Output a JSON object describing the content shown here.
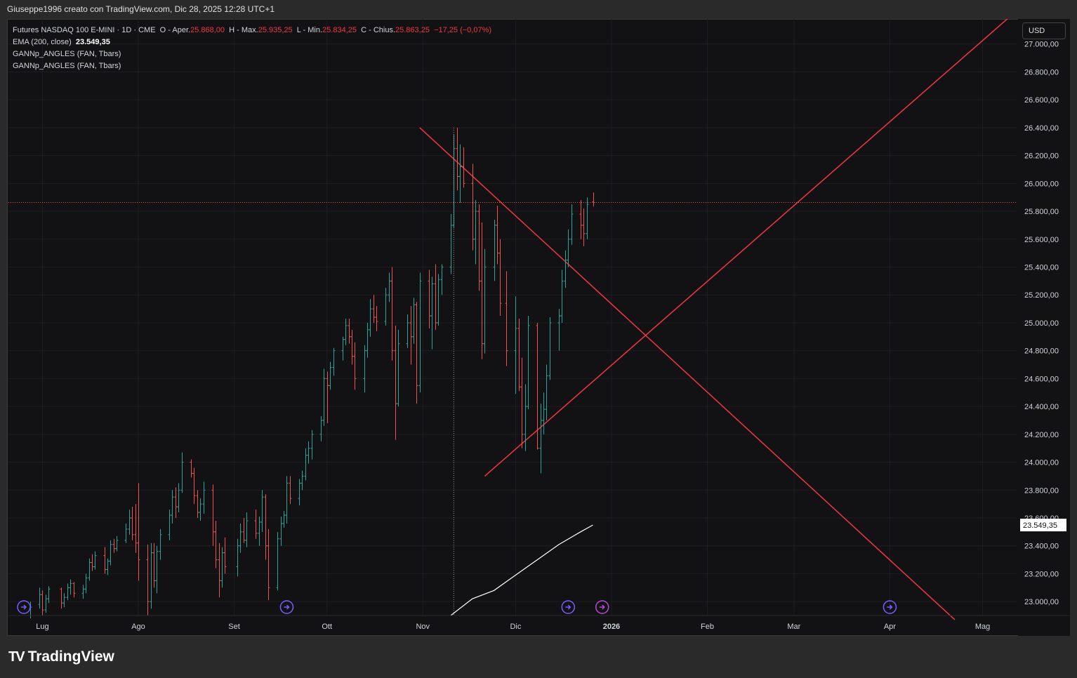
{
  "header": {
    "attribution": "Giuseppe1996 creato con TradingView.com, Dic 28, 2025 12:28 UTC+1"
  },
  "legend": {
    "symbol": "Futures NASDAQ 100 E-MINI · 1D · CME",
    "open_label": "O - Aper.",
    "open": "25.868,00",
    "high_label": "H - Max.",
    "high": "25.935,25",
    "low_label": "L - Min.",
    "low": "25.834,25",
    "close_label": "C - Chius.",
    "close": "25.863,25",
    "change": "−17,25 (−0,07%)",
    "ema_label": "EMA (200, close)",
    "ema_value": "23.549,35",
    "indicator1": "GANNp_ANGLES (FAN, Tbars)",
    "indicator2": "GANNp_ANGLES (FAN, Tbars)"
  },
  "currency": "USD",
  "footer": {
    "brand": "TradingView",
    "logo_text": "TV"
  },
  "colors": {
    "background": "#121214",
    "up": "#26a69a",
    "down": "#ef5350",
    "gann": "#f23645",
    "ema": "#ffffff",
    "event_icon": "#7b5cff",
    "event_icon_alt": "#b04dd6"
  },
  "chart_data": {
    "type": "ohlc",
    "title": "Futures NASDAQ 100 E-MINI · 1D · CME",
    "y_axis": {
      "min": 22900,
      "max": 27180,
      "ticks": [
        "27.000,00",
        "26.800,00",
        "26.600,00",
        "26.400,00",
        "26.200,00",
        "26.000,00",
        "25.800,00",
        "25.600,00",
        "25.400,00",
        "25.200,00",
        "25.000,00",
        "24.800,00",
        "24.600,00",
        "24.400,00",
        "24.200,00",
        "24.000,00",
        "23.800,00",
        "23.600,00",
        "23.400,00",
        "23.200,00",
        "23.000,00"
      ],
      "tick_values": [
        27000,
        26800,
        26600,
        26400,
        26200,
        26000,
        25800,
        25600,
        25400,
        25200,
        25000,
        24800,
        24600,
        24400,
        24200,
        24000,
        23800,
        23600,
        23400,
        23200,
        23000
      ]
    },
    "x_axis": {
      "labels": [
        "Lug",
        "Ago",
        "Set",
        "Ott",
        "Nov",
        "Dic",
        "2026",
        "Feb",
        "Mar",
        "Apr",
        "Mag"
      ],
      "label_dates": [
        "2025-07-01",
        "2025-08-01",
        "2025-09-01",
        "2025-10-01",
        "2025-11-01",
        "2025-12-01",
        "2026-01-01",
        "2026-02-01",
        "2026-03-01",
        "2026-04-01",
        "2026-05-01"
      ],
      "start": "2025-06-20",
      "end": "2026-05-12"
    },
    "grid": true,
    "last_price": 25863.25,
    "ema_value_label": "23.549,35",
    "ema_value": 23549.35,
    "ema": {
      "name": "EMA (200, close)",
      "points": [
        [
          "2025-11-10",
          22900
        ],
        [
          "2025-11-17",
          23020
        ],
        [
          "2025-11-24",
          23080
        ],
        [
          "2025-12-01",
          23190
        ],
        [
          "2025-12-08",
          23300
        ],
        [
          "2025-12-15",
          23410
        ],
        [
          "2025-12-22",
          23500
        ],
        [
          "2025-12-26",
          23549.35
        ]
      ]
    },
    "gann_lines": [
      {
        "name": "GANNp_ANGLES fan down",
        "from": [
          "2025-10-31",
          26400
        ],
        "to": [
          "2026-04-22",
          22870
        ]
      },
      {
        "name": "GANNp_ANGLES fan up",
        "from": [
          "2025-11-21",
          23900
        ],
        "to": [
          "2026-05-10",
          27200
        ]
      }
    ],
    "event_markers": [
      "2025-06-25",
      "2025-09-18",
      "2025-12-18",
      "2025-12-29",
      "2026-04-01"
    ],
    "bars": [
      [
        "2025-06-27",
        22950,
        23000,
        22880,
        22960
      ],
      [
        "2025-06-30",
        22980,
        23100,
        22950,
        23050
      ],
      [
        "2025-07-01",
        23050,
        23080,
        22900,
        22940
      ],
      [
        "2025-07-02",
        22940,
        23050,
        22920,
        23020
      ],
      [
        "2025-07-03",
        23020,
        23110,
        22990,
        23090
      ],
      [
        "2025-07-07",
        23090,
        23100,
        22950,
        22990
      ],
      [
        "2025-07-08",
        22990,
        23060,
        22960,
        23030
      ],
      [
        "2025-07-09",
        23030,
        23130,
        23010,
        23100
      ],
      [
        "2025-07-10",
        23100,
        23160,
        23050,
        23130
      ],
      [
        "2025-07-11",
        23130,
        23140,
        23030,
        23060
      ],
      [
        "2025-07-14",
        23060,
        23120,
        23020,
        23090
      ],
      [
        "2025-07-15",
        23090,
        23200,
        23060,
        23170
      ],
      [
        "2025-07-16",
        23170,
        23310,
        23150,
        23280
      ],
      [
        "2025-07-17",
        23280,
        23340,
        23220,
        23250
      ],
      [
        "2025-07-18",
        23250,
        23360,
        23230,
        23330
      ],
      [
        "2025-07-21",
        23330,
        23390,
        23200,
        23230
      ],
      [
        "2025-07-22",
        23230,
        23310,
        23190,
        23290
      ],
      [
        "2025-07-23",
        23290,
        23440,
        23260,
        23410
      ],
      [
        "2025-07-24",
        23410,
        23450,
        23350,
        23380
      ],
      [
        "2025-07-25",
        23380,
        23470,
        23360,
        23440
      ],
      [
        "2025-07-28",
        23440,
        23560,
        23420,
        23520
      ],
      [
        "2025-07-29",
        23520,
        23660,
        23480,
        23600
      ],
      [
        "2025-07-30",
        23600,
        23680,
        23440,
        23480
      ],
      [
        "2025-07-31",
        23480,
        23700,
        23350,
        23420
      ],
      [
        "2025-08-01",
        23420,
        23850,
        23150,
        23300
      ],
      [
        "2025-08-04",
        23300,
        23410,
        22900,
        23000
      ],
      [
        "2025-08-05",
        23000,
        23420,
        22950,
        23350
      ],
      [
        "2025-08-06",
        23350,
        23420,
        23100,
        23150
      ],
      [
        "2025-08-07",
        23150,
        23400,
        23060,
        23360
      ],
      [
        "2025-08-08",
        23360,
        23520,
        23300,
        23480
      ],
      [
        "2025-08-11",
        23480,
        23660,
        23440,
        23620
      ],
      [
        "2025-08-12",
        23620,
        23800,
        23560,
        23750
      ],
      [
        "2025-08-13",
        23750,
        23820,
        23600,
        23680
      ],
      [
        "2025-08-14",
        23680,
        23850,
        23640,
        23800
      ],
      [
        "2025-08-15",
        23800,
        24070,
        23780,
        24000
      ],
      [
        "2025-08-18",
        24000,
        24020,
        23890,
        23920
      ],
      [
        "2025-08-19",
        23920,
        23960,
        23700,
        23760
      ],
      [
        "2025-08-20",
        23760,
        23800,
        23600,
        23640
      ],
      [
        "2025-08-21",
        23640,
        23740,
        23580,
        23700
      ],
      [
        "2025-08-22",
        23700,
        23860,
        23630,
        23800
      ],
      [
        "2025-08-25",
        23800,
        23840,
        23400,
        23500
      ],
      [
        "2025-08-26",
        23500,
        23580,
        23240,
        23300
      ],
      [
        "2025-08-27",
        23300,
        23420,
        23030,
        23150
      ],
      [
        "2025-08-28",
        23150,
        23390,
        23100,
        23350
      ],
      [
        "2025-08-29",
        23350,
        23460,
        23200,
        23250
      ],
      [
        "2025-09-02",
        23250,
        23450,
        23180,
        23400
      ],
      [
        "2025-09-03",
        23400,
        23560,
        23350,
        23500
      ],
      [
        "2025-09-04",
        23500,
        23600,
        23420,
        23440
      ],
      [
        "2025-09-05",
        23440,
        23640,
        23390,
        23580
      ],
      [
        "2025-09-08",
        23580,
        23660,
        23450,
        23490
      ],
      [
        "2025-09-09",
        23490,
        23610,
        23400,
        23570
      ],
      [
        "2025-09-10",
        23570,
        23800,
        23500,
        23750
      ],
      [
        "2025-09-11",
        23750,
        23770,
        23300,
        23400
      ],
      [
        "2025-09-12",
        23400,
        23520,
        23010,
        23100
      ],
      [
        "2025-09-15",
        23100,
        23500,
        23080,
        23450
      ],
      [
        "2025-09-16",
        23450,
        23610,
        23400,
        23560
      ],
      [
        "2025-09-17",
        23560,
        23650,
        23530,
        23620
      ],
      [
        "2025-09-18",
        23620,
        23900,
        23560,
        23850
      ],
      [
        "2025-09-19",
        23850,
        23900,
        23700,
        23740
      ],
      [
        "2025-09-22",
        23740,
        23880,
        23690,
        23850
      ],
      [
        "2025-09-23",
        23850,
        23940,
        23800,
        23900
      ],
      [
        "2025-09-24",
        23900,
        24100,
        23870,
        24050
      ],
      [
        "2025-09-25",
        24050,
        24150,
        23990,
        24100
      ],
      [
        "2025-09-26",
        24100,
        24230,
        24020,
        24200
      ],
      [
        "2025-09-29",
        24200,
        24330,
        24150,
        24300
      ],
      [
        "2025-09-30",
        24300,
        24670,
        24260,
        24600
      ],
      [
        "2025-10-01",
        24600,
        24650,
        24280,
        24550
      ],
      [
        "2025-10-02",
        24550,
        24720,
        24520,
        24680
      ],
      [
        "2025-10-03",
        24680,
        24820,
        24620,
        24800
      ],
      [
        "2025-10-06",
        24800,
        24900,
        24730,
        24880
      ],
      [
        "2025-10-07",
        24880,
        25030,
        24840,
        24980
      ],
      [
        "2025-10-08",
        24980,
        25030,
        24850,
        24900
      ],
      [
        "2025-10-09",
        24900,
        24950,
        24700,
        24760
      ],
      [
        "2025-10-10",
        24760,
        24860,
        24520,
        24600
      ],
      [
        "2025-10-13",
        24600,
        24840,
        24500,
        24800
      ],
      [
        "2025-10-14",
        24800,
        25000,
        24750,
        24950
      ],
      [
        "2025-10-15",
        24950,
        25170,
        24900,
        25100
      ],
      [
        "2025-10-16",
        25100,
        25200,
        25000,
        25040
      ],
      [
        "2025-10-17",
        25040,
        25120,
        24940,
        25010
      ],
      [
        "2025-10-20",
        25010,
        25250,
        24980,
        25200
      ],
      [
        "2025-10-21",
        25200,
        25360,
        25150,
        25300
      ],
      [
        "2025-10-22",
        25300,
        25400,
        24730,
        24800
      ],
      [
        "2025-10-23",
        24800,
        24980,
        24160,
        24420
      ],
      [
        "2025-10-24",
        24420,
        24950,
        24400,
        24850
      ],
      [
        "2025-10-27",
        24850,
        25060,
        24820,
        25000
      ],
      [
        "2025-10-28",
        25000,
        25120,
        24700,
        24900
      ],
      [
        "2025-10-29",
        24900,
        25180,
        24850,
        25130
      ],
      [
        "2025-10-30",
        25130,
        25150,
        24420,
        24550
      ],
      [
        "2025-10-31",
        24550,
        25360,
        24500,
        25300
      ],
      [
        "2025-11-03",
        25300,
        25380,
        24960,
        25050
      ],
      [
        "2025-11-04",
        25050,
        25330,
        24810,
        25280
      ],
      [
        "2025-11-05",
        25280,
        25420,
        24950,
        25000
      ],
      [
        "2025-11-06",
        25000,
        25350,
        24980,
        25310
      ],
      [
        "2025-11-07",
        25310,
        25420,
        25200,
        25400
      ],
      [
        "2025-11-10",
        25400,
        25780,
        25350,
        25700
      ],
      [
        "2025-11-11",
        25700,
        26350,
        25680,
        26250
      ],
      [
        "2025-11-12",
        26250,
        26400,
        25950,
        26050
      ],
      [
        "2025-11-13",
        26050,
        26280,
        25860,
        26120
      ],
      [
        "2025-11-14",
        26120,
        26260,
        25970,
        26000
      ],
      [
        "2025-11-17",
        26000,
        26140,
        25520,
        25600
      ],
      [
        "2025-11-18",
        25600,
        25880,
        25420,
        25800
      ],
      [
        "2025-11-19",
        25800,
        25850,
        25230,
        25300
      ],
      [
        "2025-11-20",
        25300,
        25720,
        24740,
        24850
      ],
      [
        "2025-11-21",
        24850,
        25530,
        24780,
        25400
      ],
      [
        "2025-11-24",
        25400,
        25740,
        25300,
        25700
      ],
      [
        "2025-11-25",
        25700,
        25840,
        25420,
        25500
      ],
      [
        "2025-11-26",
        25500,
        25600,
        25050,
        25140
      ],
      [
        "2025-11-28",
        25140,
        25370,
        24690,
        24800
      ],
      [
        "2025-12-01",
        24800,
        25190,
        24490,
        24960
      ],
      [
        "2025-12-02",
        24960,
        25030,
        24510,
        24540
      ],
      [
        "2025-12-03",
        24540,
        24750,
        24100,
        24200
      ],
      [
        "2025-12-04",
        24200,
        24560,
        24080,
        24400
      ],
      [
        "2025-12-05",
        24400,
        25050,
        24380,
        24980
      ],
      [
        "2025-12-08",
        24980,
        25000,
        24090,
        24100
      ],
      [
        "2025-12-09",
        24100,
        24420,
        23920,
        24300
      ],
      [
        "2025-12-10",
        24300,
        24500,
        24200,
        24380
      ],
      [
        "2025-12-11",
        24380,
        24700,
        24300,
        24620
      ],
      [
        "2025-12-12",
        24620,
        25040,
        24590,
        25000
      ],
      [
        "2025-12-15",
        25000,
        25100,
        24800,
        25050
      ],
      [
        "2025-12-16",
        25050,
        25380,
        25000,
        25300
      ],
      [
        "2025-12-17",
        25300,
        25520,
        25250,
        25450
      ],
      [
        "2025-12-18",
        25450,
        25670,
        25400,
        25600
      ],
      [
        "2025-12-19",
        25600,
        25850,
        25560,
        25780
      ],
      [
        "2025-12-22",
        25780,
        25880,
        25600,
        25700
      ],
      [
        "2025-12-23",
        25700,
        25820,
        25550,
        25640
      ],
      [
        "2025-12-24",
        25640,
        25900,
        25600,
        25850
      ],
      [
        "2025-12-26",
        25868,
        25935.25,
        25834.25,
        25863.25
      ]
    ]
  }
}
